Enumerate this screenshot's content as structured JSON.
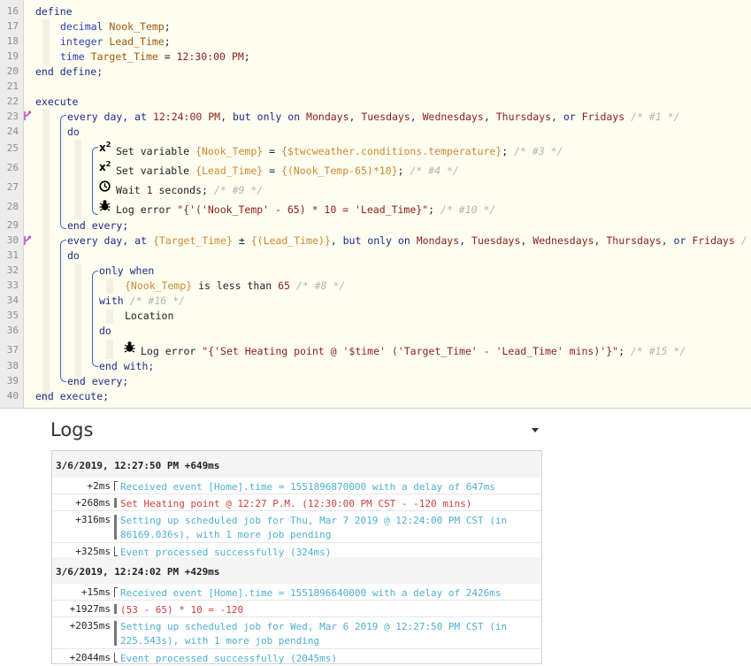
{
  "editor": {
    "line_numbers": [
      "16",
      "17",
      "18",
      "19",
      "20",
      "21",
      "22",
      "23",
      "24",
      "25",
      "26",
      "27",
      "28",
      "29",
      "30",
      "31",
      "32",
      "33",
      "34",
      "35",
      "36",
      "37",
      "38",
      "39",
      "40"
    ],
    "l16_define": "define",
    "l17_type": "decimal",
    "l17_var": "Nook_Temp",
    "l17_end": ";",
    "l18_type": "integer",
    "l18_var": "Lead_Time",
    "l18_end": ";",
    "l19_type": "time",
    "l19_var": "Target_Time",
    "l19_eq": " = ",
    "l19_val": "12:30:00 PM",
    "l19_end": ";",
    "l20_end_define": "end define;",
    "l22_execute": "execute",
    "l23_every": "every day, at ",
    "l23_time": "12:24:00 PM",
    "l23_only": ", but only on ",
    "l23_mon": "Mondays",
    "l23_tue": "Tuesdays",
    "l23_wed": "Wednesdays",
    "l23_thu": "Thursdays",
    "l23_or": ", or ",
    "l23_fri": "Fridays",
    "l23_comment": "/* #1 */",
    "comma": ", ",
    "l24_do": "do",
    "l25_set": "Set variable ",
    "l25_var": "{Nook_Temp}",
    "l25_eq": " = ",
    "l25_expr": "{$twcweather.conditions.temperature}",
    "l25_end": ";",
    "l25_comment": "/* #3 */",
    "l26_set": "Set variable ",
    "l26_var": "{Lead_Time}",
    "l26_eq": " = ",
    "l26_expr": "{(Nook_Temp-65)*10}",
    "l26_end": ";",
    "l26_comment": "/* #4 */",
    "l27_wait": "Wait ",
    "l27_num": "1",
    "l27_unit": " seconds;",
    "l27_comment": "/* #9 */",
    "l28_log": "Log error ",
    "l28_str": "\"{'('Nook_Temp' - 65) * 10 = 'Lead_Time}\"",
    "l28_end": ";",
    "l28_comment": "/* #10 */",
    "l29_end_every": "end every;",
    "l30_every": "every day, at ",
    "l30_tt": "{Target_Time}",
    "l30_pm": " ± ",
    "l30_lt": "{(Lead_Time)}",
    "l30_only": ", but only on ",
    "l30_mon": "Mondays",
    "l30_tue": "Tuesdays",
    "l30_wed": "Wednesdays",
    "l30_thu": "Thursdays",
    "l30_or": ", or ",
    "l30_fri": "Fridays",
    "l30_tail": " /",
    "l31_do": "do",
    "l32_only_when": "only when",
    "l33_var": "{Nook_Temp}",
    "l33_text": " is less than ",
    "l33_num": "65",
    "l33_comment": "/* #8 */",
    "l34_with": "with",
    "l34_comment": "/* #16 */",
    "l35_location": "Location",
    "l36_do": "do",
    "l37_log": "Log error ",
    "l37_str": "\"{'Set Heating point @ '$time' ('Target_Time' - 'Lead_Time' mins)'}\"",
    "l37_end": ";",
    "l37_comment": "/* #15 */",
    "l38_end_with": "end with;",
    "l39_end_every": "end every;",
    "l40_end_execute": "end execute;",
    "superscript_label": "x",
    "superscript_two": "2"
  },
  "logs": {
    "title": "Logs",
    "groups": [
      {
        "timestamp": "3/6/2019, 12:27:50 PM +649ms",
        "entries": [
          {
            "delta": "+2ms",
            "text": "Received event [Home].time = 1551896870000 with a delay of 647ms",
            "level": "info"
          },
          {
            "delta": "+268ms",
            "text": "Set Heating point @ 12:27 P.M. (12:30:00 PM CST - -120 mins)",
            "level": "error"
          },
          {
            "delta": "+316ms",
            "text": "Setting up scheduled job for Thu, Mar 7 2019 @ 12:24:00 PM CST (in 86169.036s), with 1 more job pending",
            "level": "info"
          },
          {
            "delta": "+325ms",
            "text": "Event processed successfully (324ms)",
            "level": "info"
          }
        ]
      },
      {
        "timestamp": "3/6/2019, 12:24:02 PM +429ms",
        "entries": [
          {
            "delta": "+15ms",
            "text": "Received event [Home].time = 1551896640000 with a delay of 2426ms",
            "level": "info"
          },
          {
            "delta": "+1927ms",
            "text": "(53 - 65) * 10 = -120",
            "level": "error"
          },
          {
            "delta": "+2035ms",
            "text": "Setting up scheduled job for Wed, Mar 6 2019 @ 12:27:50 PM CST (in 225.543s), with 1 more job pending",
            "level": "info"
          },
          {
            "delta": "+2044ms",
            "text": "Event processed successfully (2045ms)",
            "level": "info"
          }
        ]
      }
    ]
  },
  "colors": {
    "keyword": "#1e2a86",
    "variable": "#9c5a10",
    "literal": "#8a1e1e",
    "comment": "#b4b4b4",
    "log_info": "#4db0cf",
    "log_error": "#cc4040",
    "trigger_icon": "#c050c0"
  }
}
